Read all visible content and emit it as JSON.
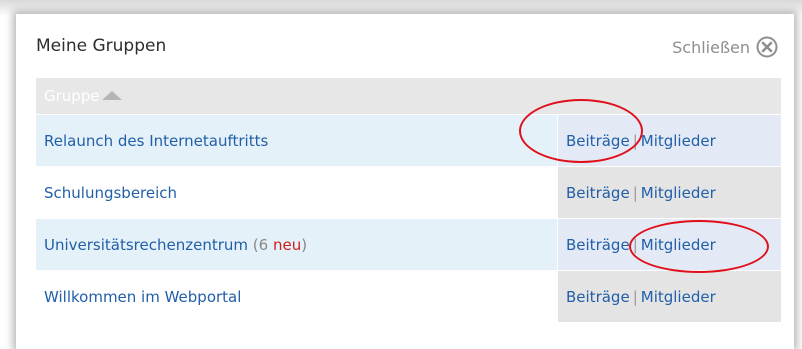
{
  "dialog": {
    "title": "Meine Gruppen",
    "close_label": "Schließen",
    "close_icon": "close-circle-icon"
  },
  "table": {
    "column_header": "Gruppe",
    "sort_icon": "sort-ascending-icon",
    "rows": [
      {
        "name": "Relaunch des Internetauftritts",
        "posts": "Beiträge",
        "members": "Mitglieder"
      },
      {
        "name": "Schulungsbereich",
        "posts": "Beiträge",
        "members": "Mitglieder"
      },
      {
        "name": "Universitätsrechenzentrum",
        "count_open": "(6",
        "count_new": "neu",
        "count_close": ")",
        "posts": "Beiträge",
        "members": "Mitglieder"
      },
      {
        "name": "Willkommen im Webportal",
        "posts": "Beiträge",
        "members": "Mitglieder"
      }
    ],
    "separator": "|"
  },
  "annotation_color": "#e0101b"
}
